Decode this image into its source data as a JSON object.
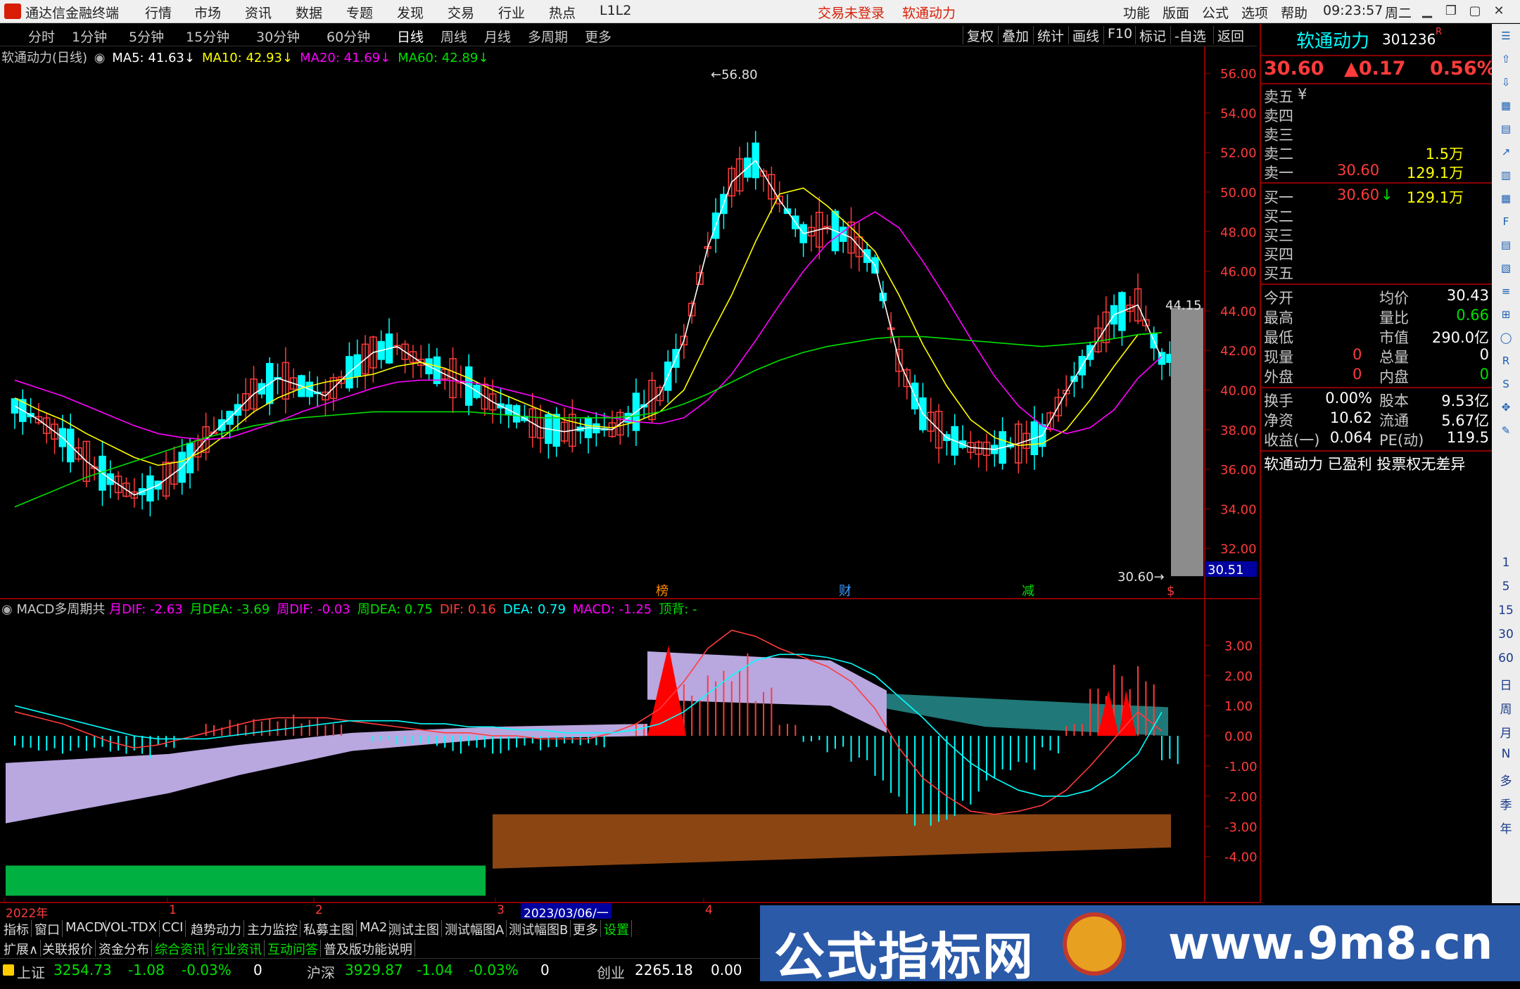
{
  "titlebar": {
    "app_name": "通达信金融终端",
    "menus": [
      "行情",
      "市场",
      "资讯",
      "数据",
      "专题",
      "发现",
      "交易",
      "行业",
      "热点",
      "L1L2"
    ],
    "login_status": "交易未登录",
    "stock_name": "软通动力",
    "right_menus": [
      "功能",
      "版面",
      "公式",
      "选项",
      "帮助"
    ],
    "time": "09:23:57",
    "weekday": "周二"
  },
  "periodbar": {
    "periods": [
      "分时",
      "1分钟",
      "5分钟",
      "15分钟",
      "30分钟",
      "60分钟",
      "日线",
      "周线",
      "月线",
      "多周期",
      "更多"
    ],
    "active_period": "日线",
    "tools": [
      "复权",
      "叠加",
      "统计",
      "画线",
      "F10",
      "标记",
      "-自选",
      "返回"
    ]
  },
  "main_chart": {
    "header": "软通动力(日线)",
    "ma": [
      {
        "label": "MA5: 41.63",
        "color": "#ffffff"
      },
      {
        "label": "MA10: 42.93",
        "color": "#ffff00"
      },
      {
        "label": "MA20: 41.69",
        "color": "#ff00ff"
      },
      {
        "label": "MA60: 42.89",
        "color": "#00e000"
      }
    ],
    "high_label": "56.80",
    "low_label": "30.60",
    "last_label": "44.15",
    "price_tag": "30.51",
    "markers": [
      "榜",
      "财",
      "减",
      "$"
    ]
  },
  "macd_panel": {
    "header": "MACD多周期共",
    "items": [
      {
        "label": "月DIF: -2.63",
        "color": "#ff00ff"
      },
      {
        "label": "月DEA: -3.69",
        "color": "#00e000"
      },
      {
        "label": "周DIF: -0.03",
        "color": "#ff00ff"
      },
      {
        "label": "周DEA: 0.75",
        "color": "#00e000"
      },
      {
        "label": "DIF: 0.16",
        "color": "#ff3b3b"
      },
      {
        "label": "DEA: 0.79",
        "color": "#00ffff"
      },
      {
        "label": "MACD: -1.25",
        "color": "#ff00ff"
      },
      {
        "label": "顶背: -",
        "color": "#00e000"
      }
    ]
  },
  "chart_data": [
    {
      "type": "line",
      "title": "软通动力(日线)",
      "ylim": [
        30,
        57
      ],
      "y_ticks": [
        "56.00",
        "54.00",
        "52.00",
        "50.00",
        "48.00",
        "46.00",
        "44.00",
        "42.00",
        "40.00",
        "38.00",
        "36.00",
        "34.00",
        "32.00"
      ],
      "series": [
        {
          "name": "MA5",
          "values": [
            39.2,
            38.5,
            37.6,
            36.4,
            35.5,
            34.7,
            35.2,
            36.1,
            37.5,
            38.6,
            39.8,
            40.6,
            40.2,
            39.7,
            40.9,
            41.9,
            42.2,
            41.4,
            40.8,
            40.2,
            39.4,
            38.8,
            38.1,
            37.9,
            38.1,
            38.0,
            38.9,
            39.8,
            42.5,
            47.2,
            50.5,
            51.6,
            49.6,
            47.9,
            48.2,
            47.7,
            46.3,
            41.5,
            38.8,
            37.6,
            37.1,
            37.0,
            37.3,
            37.7,
            39.9,
            41.9,
            43.8,
            44.3,
            41.6
          ]
        },
        {
          "name": "MA10",
          "values": [
            39.6,
            39.0,
            38.5,
            37.8,
            37.2,
            36.6,
            36.2,
            36.4,
            37.0,
            37.9,
            38.9,
            39.6,
            40.1,
            40.4,
            40.6,
            40.8,
            41.2,
            41.4,
            41.1,
            40.6,
            40.0,
            39.5,
            39.0,
            38.5,
            38.2,
            38.1,
            38.4,
            38.9,
            40.0,
            42.5,
            44.8,
            47.5,
            49.9,
            50.2,
            49.3,
            48.2,
            47.0,
            44.8,
            42.3,
            40.2,
            38.5,
            37.6,
            37.2,
            37.3,
            38.0,
            39.5,
            41.2,
            42.8,
            42.9
          ]
        },
        {
          "name": "MA20",
          "values": [
            40.5,
            40.1,
            39.7,
            39.2,
            38.7,
            38.2,
            37.8,
            37.6,
            37.5,
            37.6,
            38.0,
            38.4,
            38.9,
            39.3,
            39.7,
            40.1,
            40.4,
            40.5,
            40.5,
            40.4,
            40.2,
            39.9,
            39.6,
            39.2,
            38.9,
            38.6,
            38.4,
            38.3,
            38.6,
            39.5,
            40.8,
            42.5,
            44.3,
            46.0,
            47.4,
            48.3,
            49.0,
            48.2,
            46.5,
            44.6,
            42.6,
            40.7,
            39.2,
            38.2,
            37.8,
            38.1,
            39.0,
            40.6,
            41.7
          ]
        },
        {
          "name": "MA60",
          "values": [
            34.1,
            34.6,
            35.1,
            35.6,
            36.0,
            36.4,
            36.8,
            37.2,
            37.6,
            37.9,
            38.2,
            38.4,
            38.6,
            38.7,
            38.8,
            38.9,
            38.9,
            38.9,
            38.9,
            38.9,
            38.8,
            38.7,
            38.6,
            38.6,
            38.6,
            38.6,
            38.7,
            38.9,
            39.3,
            39.8,
            40.4,
            41.0,
            41.5,
            41.9,
            42.2,
            42.4,
            42.6,
            42.7,
            42.7,
            42.6,
            42.5,
            42.4,
            42.3,
            42.2,
            42.3,
            42.4,
            42.6,
            42.8,
            42.9
          ]
        }
      ]
    },
    {
      "type": "bar",
      "title": "MACD多周期共",
      "ylim": [
        -5.5,
        4.2
      ],
      "y_ticks": [
        "3.00",
        "2.00",
        "1.00",
        "0.00",
        "-1.00",
        "-2.00",
        "-3.00",
        "-4.00"
      ],
      "series": [
        {
          "name": "DIF",
          "values": [
            0.8,
            0.6,
            0.4,
            0.1,
            -0.2,
            -0.4,
            -0.3,
            -0.1,
            0.1,
            0.3,
            0.5,
            0.6,
            0.6,
            0.6,
            0.5,
            0.4,
            0.3,
            0.2,
            0.1,
            0.1,
            0.0,
            0.0,
            -0.1,
            -0.1,
            -0.1,
            0.1,
            0.4,
            0.9,
            1.8,
            2.9,
            3.5,
            3.3,
            2.9,
            2.6,
            2.3,
            1.8,
            0.9,
            -0.4,
            -1.4,
            -2.0,
            -2.5,
            -2.6,
            -2.5,
            -2.3,
            -1.8,
            -1.0,
            -0.1,
            0.8,
            0.16
          ]
        },
        {
          "name": "DEA",
          "values": [
            1.0,
            0.8,
            0.6,
            0.4,
            0.2,
            0.0,
            -0.1,
            -0.1,
            -0.1,
            0.0,
            0.1,
            0.2,
            0.3,
            0.4,
            0.5,
            0.5,
            0.5,
            0.4,
            0.4,
            0.3,
            0.3,
            0.2,
            0.2,
            0.1,
            0.1,
            0.1,
            0.2,
            0.4,
            0.8,
            1.4,
            2.0,
            2.5,
            2.7,
            2.7,
            2.6,
            2.4,
            2.0,
            1.3,
            0.6,
            -0.2,
            -0.9,
            -1.4,
            -1.8,
            -2.0,
            -2.0,
            -1.8,
            -1.3,
            -0.6,
            0.79
          ]
        },
        {
          "name": "MACD",
          "values": [
            -0.4,
            -0.5,
            -0.6,
            -0.6,
            -0.8,
            -0.8,
            -0.4,
            0.0,
            0.4,
            0.6,
            0.8,
            0.8,
            0.6,
            0.4,
            0.0,
            -0.2,
            -0.4,
            -0.4,
            -0.6,
            -0.4,
            -0.6,
            -0.4,
            -0.6,
            -0.4,
            -0.4,
            0.0,
            0.4,
            1.0,
            2.0,
            3.0,
            3.0,
            1.6,
            0.4,
            -0.2,
            -0.6,
            -1.2,
            -2.2,
            -3.0,
            -3.0,
            -2.8,
            -2.4,
            -1.8,
            -1.4,
            -0.6,
            0.4,
            1.6,
            2.4,
            2.8,
            -1.25
          ]
        }
      ]
    }
  ],
  "xaxis": {
    "labels": [
      "2022年",
      "1",
      "2",
      "3",
      "4"
    ],
    "highlight_date": "2023/03/06/一"
  },
  "quote": {
    "name": "软通动力",
    "code": "301236",
    "code_sup": "R",
    "price": "30.60",
    "change": "▲0.17",
    "pct": "0.56%",
    "sell": [
      {
        "label": "卖五",
        "price": "",
        "vol": "",
        "note": "¥"
      },
      {
        "label": "卖四",
        "price": "",
        "vol": "",
        "note": ""
      },
      {
        "label": "卖三",
        "price": "",
        "vol": "",
        "note": ""
      },
      {
        "label": "卖二",
        "price": "",
        "vol": "1.5万",
        "note": ""
      },
      {
        "label": "卖一",
        "price": "30.60",
        "vol": "129.1万",
        "note": ""
      }
    ],
    "buy": [
      {
        "label": "买一",
        "price": "30.60",
        "vol": "129.1万",
        "note": "↓"
      },
      {
        "label": "买二",
        "price": "",
        "vol": "",
        "note": ""
      },
      {
        "label": "买三",
        "price": "",
        "vol": "",
        "note": ""
      },
      {
        "label": "买四",
        "price": "",
        "vol": "",
        "note": ""
      },
      {
        "label": "买五",
        "price": "",
        "vol": "",
        "note": ""
      }
    ],
    "stats": [
      {
        "k1": "今开",
        "v1": "",
        "c1": "#fff",
        "k2": "均价",
        "v2": "30.43",
        "c2": "#fff"
      },
      {
        "k1": "最高",
        "v1": "",
        "c1": "#fff",
        "k2": "量比",
        "v2": "0.66",
        "c2": "#00e000"
      },
      {
        "k1": "最低",
        "v1": "",
        "c1": "#fff",
        "k2": "市值",
        "v2": "290.0亿",
        "c2": "#fff"
      },
      {
        "k1": "现量",
        "v1": "0",
        "c1": "#ff3b3b",
        "k2": "总量",
        "v2": "0",
        "c2": "#fff"
      },
      {
        "k1": "外盘",
        "v1": "0",
        "c1": "#ff3b3b",
        "k2": "内盘",
        "v2": "0",
        "c2": "#00e000"
      }
    ],
    "stats2": [
      {
        "k1": "换手",
        "v1": "0.00%",
        "k2": "股本",
        "v2": "9.53亿"
      },
      {
        "k1": "净资",
        "v1": "10.62",
        "k2": "流通",
        "v2": "5.67亿"
      },
      {
        "k1": "收益(一)",
        "v1": "0.064",
        "k2": "PE(动)",
        "v2": "119.5"
      }
    ],
    "footer": "软通动力 已盈利 投票权无差异"
  },
  "right_toolbar": [
    "1",
    "5",
    "15",
    "30",
    "60",
    "日",
    "周",
    "月",
    "N",
    "多",
    "季",
    "年"
  ],
  "tabs1": [
    "指标",
    "窗口",
    "MACD",
    "VOL-TDX",
    "CCI",
    "趋势动力",
    "主力监控",
    "私募主图",
    "MA2",
    "测试主图",
    "测试幅图A",
    "测试幅图B",
    "更多",
    "设置"
  ],
  "tabs2": [
    "扩展∧",
    "关联报价",
    "资金分布",
    "综合资讯",
    "行业资讯",
    "互动问答",
    "普及版功能说明"
  ],
  "status": {
    "sh_name": "上证",
    "sh_val": "3254.73",
    "sh_chg": "-1.08",
    "sh_pct": "-0.03%",
    "sh_vol": "0",
    "hs_name": "沪深",
    "hs_val": "3929.87",
    "hs_chg": "-1.04",
    "hs_pct": "-0.03%",
    "hs_vol": "0",
    "cy_name": "创业",
    "cy_val": "2265.18",
    "cy_chg": "0.00"
  },
  "banner": {
    "title": "公式指标网",
    "url": "www.9m8.cn"
  }
}
